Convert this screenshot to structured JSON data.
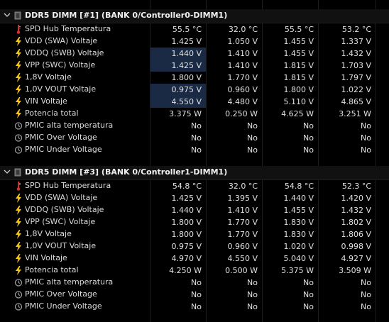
{
  "sections": [
    {
      "title": "DDR5 DIMM [#1] (BANK 0/Controller0-DIMM1)",
      "rows": [
        {
          "icon": "thermometer-icon",
          "label": "SPD Hub Temperatura",
          "v": [
            "55.5 °C",
            "32.0 °C",
            "55.5 °C",
            "53.2 °C"
          ],
          "hl": false
        },
        {
          "icon": "bolt-icon",
          "label": "VDD (SWA) Voltaje",
          "v": [
            "1.425 V",
            "1.050 V",
            "1.455 V",
            "1.337 V"
          ],
          "hl": false
        },
        {
          "icon": "bolt-icon",
          "label": "VDDQ (SWB) Voltaje",
          "v": [
            "1.440 V",
            "1.410 V",
            "1.455 V",
            "1.432 V"
          ],
          "hl": true
        },
        {
          "icon": "bolt-icon",
          "label": "VPP (SWC) Voltaje",
          "v": [
            "1.425 V",
            "1.410 V",
            "1.815 V",
            "1.703 V"
          ],
          "hl": true
        },
        {
          "icon": "bolt-icon",
          "label": "1,8V Voltaje",
          "v": [
            "1.800 V",
            "1.770 V",
            "1.815 V",
            "1.797 V"
          ],
          "hl": false
        },
        {
          "icon": "bolt-icon",
          "label": "1,0V VOUT Voltaje",
          "v": [
            "0.975 V",
            "0.960 V",
            "1.800 V",
            "1.022 V"
          ],
          "hl": true
        },
        {
          "icon": "bolt-icon",
          "label": "VIN Voltaje",
          "v": [
            "4.550 V",
            "4.480 V",
            "5.110 V",
            "4.865 V"
          ],
          "hl": true
        },
        {
          "icon": "bolt-icon",
          "label": "Potencia total",
          "v": [
            "3.375 W",
            "0.250 W",
            "4.625 W",
            "3.251 W"
          ],
          "hl": false
        },
        {
          "icon": "clock-icon",
          "label": "PMIC alta temperatura",
          "v": [
            "No",
            "No",
            "No",
            "No"
          ],
          "hl": false
        },
        {
          "icon": "clock-icon",
          "label": "PMIC Over Voltage",
          "v": [
            "No",
            "No",
            "No",
            "No"
          ],
          "hl": false
        },
        {
          "icon": "clock-icon",
          "label": "PMIC Under Voltage",
          "v": [
            "No",
            "No",
            "No",
            "No"
          ],
          "hl": false
        }
      ]
    },
    {
      "title": "DDR5 DIMM [#3] (BANK 0/Controller1-DIMM1)",
      "rows": [
        {
          "icon": "thermometer-icon",
          "label": "SPD Hub Temperatura",
          "v": [
            "54.8 °C",
            "32.0 °C",
            "54.8 °C",
            "52.3 °C"
          ],
          "hl": false
        },
        {
          "icon": "bolt-icon",
          "label": "VDD (SWA) Voltaje",
          "v": [
            "1.425 V",
            "1.395 V",
            "1.440 V",
            "1.420 V"
          ],
          "hl": false
        },
        {
          "icon": "bolt-icon",
          "label": "VDDQ (SWB) Voltaje",
          "v": [
            "1.440 V",
            "1.410 V",
            "1.455 V",
            "1.432 V"
          ],
          "hl": false
        },
        {
          "icon": "bolt-icon",
          "label": "VPP (SWC) Voltaje",
          "v": [
            "1.800 V",
            "1.770 V",
            "1.830 V",
            "1.802 V"
          ],
          "hl": false
        },
        {
          "icon": "bolt-icon",
          "label": "1,8V Voltaje",
          "v": [
            "1.800 V",
            "1.770 V",
            "1.830 V",
            "1.806 V"
          ],
          "hl": false
        },
        {
          "icon": "bolt-icon",
          "label": "1,0V VOUT Voltaje",
          "v": [
            "0.975 V",
            "0.960 V",
            "1.020 V",
            "0.998 V"
          ],
          "hl": false
        },
        {
          "icon": "bolt-icon",
          "label": "VIN Voltaje",
          "v": [
            "4.970 V",
            "4.550 V",
            "5.040 V",
            "4.927 V"
          ],
          "hl": false
        },
        {
          "icon": "bolt-icon",
          "label": "Potencia total",
          "v": [
            "4.250 W",
            "0.500 W",
            "5.375 W",
            "3.509 W"
          ],
          "hl": false
        },
        {
          "icon": "clock-icon",
          "label": "PMIC alta temperatura",
          "v": [
            "No",
            "No",
            "No",
            "No"
          ],
          "hl": false
        },
        {
          "icon": "clock-icon",
          "label": "PMIC Over Voltage",
          "v": [
            "No",
            "No",
            "No",
            "No"
          ],
          "hl": false
        },
        {
          "icon": "clock-icon",
          "label": "PMIC Under Voltage",
          "v": [
            "No",
            "No",
            "No",
            "No"
          ],
          "hl": false
        }
      ]
    }
  ],
  "colors": {
    "background": "#000000",
    "highlight": "#1a2a44",
    "bolt": "#f5c518",
    "thermometer": "#d03030"
  }
}
